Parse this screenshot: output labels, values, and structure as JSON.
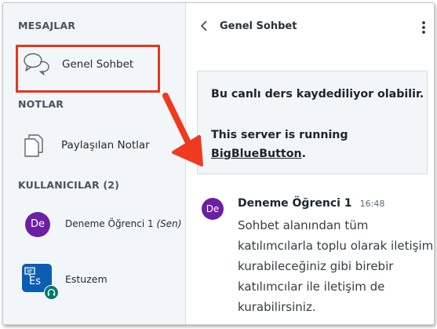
{
  "sidebar": {
    "messages_title": "MESAJLAR",
    "public_chat_label": "Genel Sohbet",
    "notes_title": "NOTLAR",
    "shared_notes_label": "Paylaşılan Notlar",
    "users_title": "KULLANICILAR (2)",
    "users": [
      {
        "initials": "De",
        "name": "Deneme Öğrenci 1",
        "self_tag": "(Sen)",
        "avatar_color": "#6b1fa4"
      },
      {
        "initials": "Es",
        "name": "Estuzem",
        "avatar_color": "#0b5db3",
        "status_color": "#00796b"
      }
    ]
  },
  "chat": {
    "title": "Genel Sohbet",
    "notice_line1": "Bu canlı ders kaydediliyor olabilir.",
    "notice_line2": "This server is running",
    "notice_link": "BigBlueButton",
    "notice_period": ".",
    "message": {
      "author_initials": "De",
      "author": "Deneme Öğrenci 1",
      "time": "16:48",
      "lines": [
        "Sohbet alanından tüm",
        "katılımcılarla toplu olarak iletişim",
        "kurabileceğiniz gibi birebir",
        "katılımcılar ile iletişim de",
        "kurabilirsiniz."
      ]
    }
  },
  "annotation": {
    "highlight_color": "#e8341c",
    "arrow_color": "#ef3a1f"
  },
  "icons": [
    "chat-bubbles-icon",
    "notes-icon",
    "presenter-icon",
    "headset-icon",
    "back-chevron-icon",
    "more-options-icon"
  ]
}
